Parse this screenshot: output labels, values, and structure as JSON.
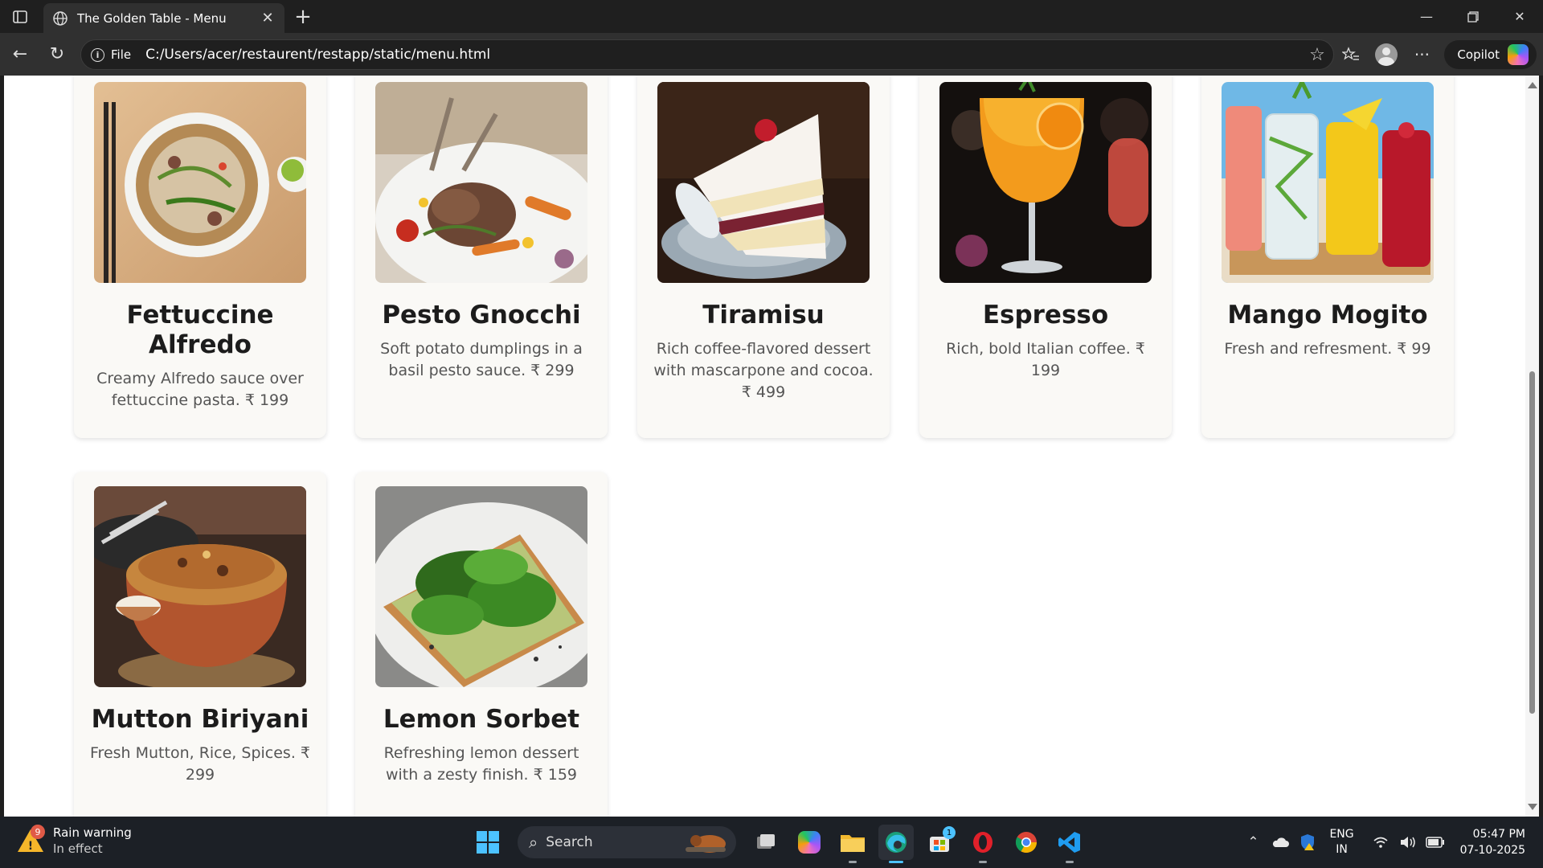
{
  "browser": {
    "tab_title": "The Golden Table - Menu",
    "url_scheme_label": "File",
    "url": "C:/Users/acer/restaurent/restapp/static/menu.html",
    "copilot_label": "Copilot"
  },
  "menu": {
    "items": [
      {
        "name": "Fettuccine Alfredo",
        "description": "Creamy Alfredo sauce over fettuccine pasta. ₹ 199",
        "photo": "pho-noodle-soup-bowl"
      },
      {
        "name": "Pesto Gnocchi",
        "description": "Soft potato dumplings in a basil pesto sauce. ₹ 299",
        "photo": "lamb-chops-plate"
      },
      {
        "name": "Tiramisu",
        "description": "Rich coffee-flavored dessert with mascarpone and cocoa. ₹ 499",
        "photo": "layered-cake-slice"
      },
      {
        "name": "Espresso",
        "description": "Rich, bold Italian coffee. ₹ 199",
        "photo": "orange-cocktail-glass"
      },
      {
        "name": "Mango Mogito",
        "description": "Fresh and refresment. ₹ 99",
        "photo": "colorful-mojito-glasses"
      },
      {
        "name": "Mutton Biriyani",
        "description": "Fresh Mutton, Rice, Spices. ₹ 299",
        "photo": "biryani-clay-pot"
      },
      {
        "name": "Lemon Sorbet",
        "description": "Refreshing lemon dessert with a zesty finish. ₹ 159",
        "photo": "spinach-avocado-toast"
      }
    ]
  },
  "taskbar": {
    "weather_title": "Rain warning",
    "weather_subtitle": "In effect",
    "weather_badge": "9",
    "search_placeholder": "Search",
    "store_badge": "1",
    "lang_top": "ENG",
    "lang_bottom": "IN",
    "time": "05:47 PM",
    "date": "07-10-2025"
  }
}
